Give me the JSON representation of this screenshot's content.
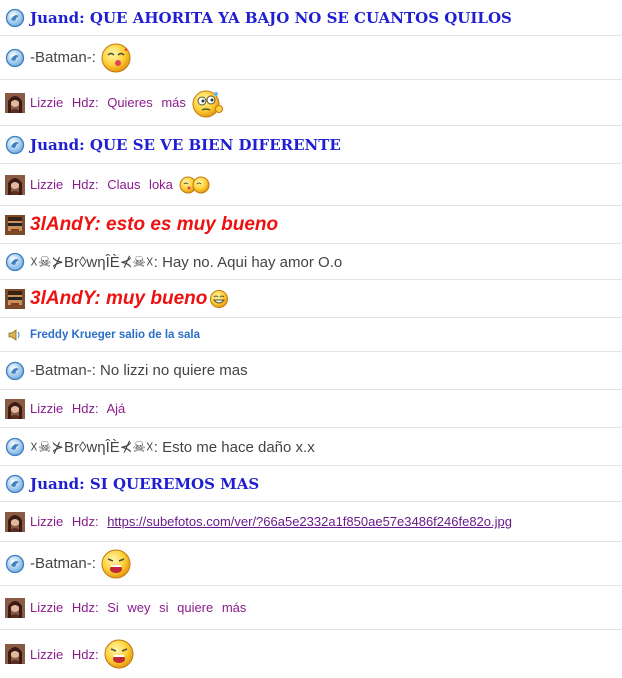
{
  "messages": [
    {
      "user": "Juand",
      "text": "QUE AHORITA YA BAJO NO SE CUANTOS QUILOS"
    },
    {
      "user": "-Batman-",
      "text": "",
      "emoticon": "kiss-emoticon"
    },
    {
      "user": "Lizzie Hdz",
      "text": "Quieres más",
      "emoticon": "thinking-emoticon"
    },
    {
      "user": "Juand",
      "text": "QUE SE VE BIEN DIFERENTE"
    },
    {
      "user": "Lizzie Hdz",
      "text": "Claus loka",
      "emoticon": "hug-emoticon"
    },
    {
      "user": "3lAndY",
      "text": "esto es muy bueno"
    },
    {
      "user": "☓☠⊁Br◊wηÎÈ⊀☠☓",
      "text": "Hay no. Aqui hay amor O.o"
    },
    {
      "user": "3lAndY",
      "text": "muy bueno",
      "emoticon": "laugh-emoticon"
    },
    {
      "system": "Freddy Krueger salio de la sala"
    },
    {
      "user": "-Batman-",
      "text": "No lizzi no quiere mas"
    },
    {
      "user": "Lizzie Hdz",
      "text": "Ajá"
    },
    {
      "user": "☓☠⊁Br◊wηÎÈ⊀☠☓",
      "text": "Esto me hace daño x.x"
    },
    {
      "user": "Juand",
      "text": "SI QUEREMOS MAS"
    },
    {
      "user": "Lizzie Hdz",
      "link": "https://subefotos.com/ver/?66a5e2332a1f850ae57e3486f246fe82o.jpg"
    },
    {
      "user": "-Batman-",
      "text": "",
      "emoticon": "crying-emoticon"
    },
    {
      "user": "Lizzie Hdz",
      "text": "Si wey si quiere más"
    },
    {
      "user": "Lizzie Hdz",
      "text": "",
      "emoticon": "crying-emoticon"
    }
  ],
  "colors": {
    "juand": "#1f1fd1",
    "lizzie": "#8c1c8c",
    "andy": "#ee1111",
    "system": "#2a6fc8",
    "plain": "#444444"
  }
}
